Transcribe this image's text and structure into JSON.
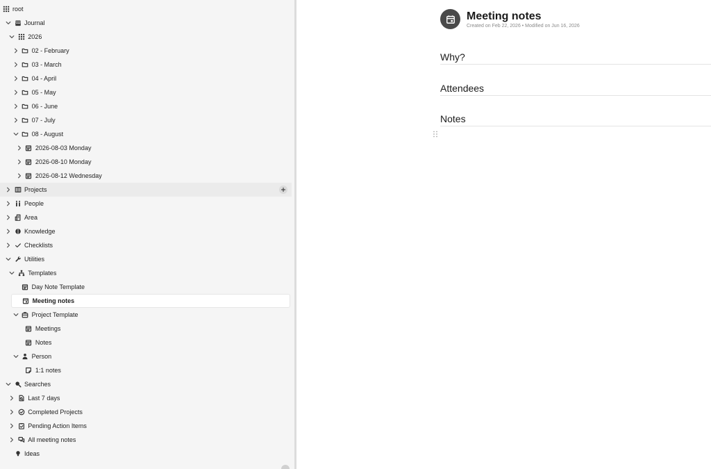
{
  "sidebar": {
    "items": [
      {
        "label": "root",
        "icon": "grid-icon",
        "expander": "none"
      },
      {
        "label": "Journal",
        "icon": "calendar-icon",
        "expander": "expanded"
      },
      {
        "label": "2026",
        "icon": "grid-icon",
        "expander": "expanded"
      },
      {
        "label": "02 - February",
        "icon": "folder-icon",
        "expander": "collapsed"
      },
      {
        "label": "03 - March",
        "icon": "folder-icon",
        "expander": "collapsed"
      },
      {
        "label": "04 - April",
        "icon": "folder-icon",
        "expander": "collapsed"
      },
      {
        "label": "05 - May",
        "icon": "folder-icon",
        "expander": "collapsed"
      },
      {
        "label": "06 - June",
        "icon": "folder-icon",
        "expander": "collapsed"
      },
      {
        "label": "07 - July",
        "icon": "folder-icon",
        "expander": "collapsed"
      },
      {
        "label": "08 - August",
        "icon": "folder-icon",
        "expander": "expanded"
      },
      {
        "label": "2026-08-03 Monday",
        "icon": "calendar-day-icon",
        "expander": "collapsed"
      },
      {
        "label": "2026-08-10 Monday",
        "icon": "calendar-day-icon",
        "expander": "collapsed"
      },
      {
        "label": "2026-08-12 Wednesday",
        "icon": "calendar-day-icon",
        "expander": "collapsed"
      },
      {
        "label": "Projects",
        "icon": "board-icon",
        "expander": "collapsed"
      },
      {
        "label": "People",
        "icon": "people-icon",
        "expander": "collapsed"
      },
      {
        "label": "Area",
        "icon": "building-icon",
        "expander": "collapsed"
      },
      {
        "label": "Knowledge",
        "icon": "brain-icon",
        "expander": "collapsed"
      },
      {
        "label": "Checklists",
        "icon": "check-icon",
        "expander": "collapsed"
      },
      {
        "label": "Utilities",
        "icon": "wrench-icon",
        "expander": "expanded"
      },
      {
        "label": "Templates",
        "icon": "sitemap-icon",
        "expander": "expanded"
      },
      {
        "label": "Day Note Template",
        "icon": "calendar-day-icon",
        "expander": "none"
      },
      {
        "label": "Meeting notes",
        "icon": "calendar-event-icon",
        "expander": "none"
      },
      {
        "label": "Project Template",
        "icon": "briefcase-icon",
        "expander": "expanded"
      },
      {
        "label": "Meetings",
        "icon": "calendar-day-icon",
        "expander": "none"
      },
      {
        "label": "Notes",
        "icon": "calendar-day-icon",
        "expander": "none"
      },
      {
        "label": "Person",
        "icon": "person-icon",
        "expander": "expanded"
      },
      {
        "label": "1:1 notes",
        "icon": "note-icon",
        "expander": "none"
      },
      {
        "label": "Searches",
        "icon": "search-icon",
        "expander": "expanded"
      },
      {
        "label": "Last 7 days",
        "icon": "file-search-icon",
        "expander": "collapsed"
      },
      {
        "label": "Completed Projects",
        "icon": "circle-check-icon",
        "expander": "collapsed"
      },
      {
        "label": "Pending Action Items",
        "icon": "clipboard-check-icon",
        "expander": "collapsed"
      },
      {
        "label": "All meeting notes",
        "icon": "chat-icon",
        "expander": "collapsed"
      },
      {
        "label": "Ideas",
        "icon": "bulb-icon",
        "expander": "none"
      }
    ]
  },
  "note": {
    "title": "Meeting notes",
    "meta": "Created on Feb 22, 2026 • Modified on Jun 16, 2026",
    "icon": "calendar-event-icon",
    "headings": [
      "Why?",
      "Attendees",
      "Notes"
    ]
  },
  "colors": {
    "sidebar_bg": "#f5f5f5",
    "active_row_bg": "#ffffff",
    "note_icon_bg": "#4a4a4a"
  }
}
